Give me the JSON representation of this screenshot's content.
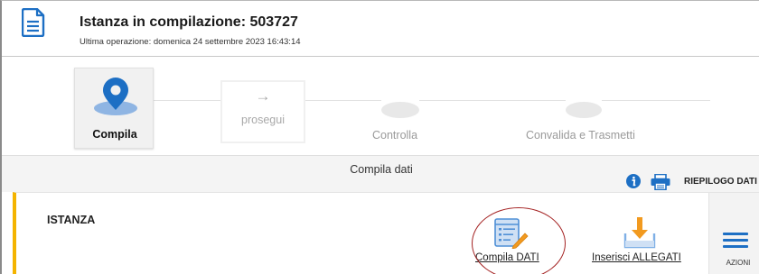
{
  "header": {
    "title": "Istanza in compilazione: 503727",
    "subtitle": "Ultima operazione: domenica 24 settembre 2023 16:43:14",
    "icon": "document-icon"
  },
  "stepper": {
    "active_step": "Compila",
    "next_button": {
      "arrow": "→",
      "label": "prosegui"
    },
    "steps": [
      "Compila",
      "Controlla",
      "Convalida e Trasmetti"
    ]
  },
  "section_band": {
    "title": "Compila dati",
    "summary_label": "RIEPILOGO DATI"
  },
  "card": {
    "title": "ISTANZA",
    "actions": [
      {
        "label": "Compila DATI",
        "icon": "form-edit-icon"
      },
      {
        "label": "Inserisci ALLEGATI",
        "icon": "download-icon"
      }
    ],
    "menu_label": "AZIONI"
  },
  "colors": {
    "accent_blue": "#1d6fc4",
    "accent_yellow": "#f4b400",
    "highlight_red": "#a32020"
  }
}
